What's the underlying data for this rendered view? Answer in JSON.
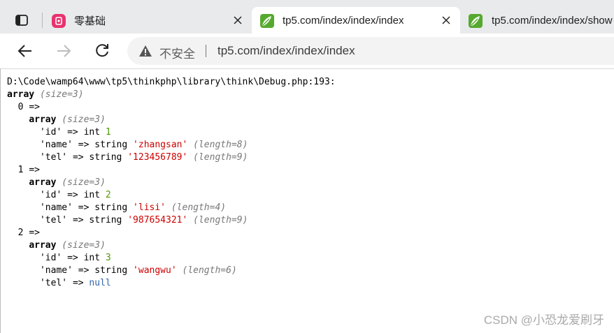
{
  "tabs": [
    {
      "title": "零基础",
      "favicon": "pink-app-icon"
    },
    {
      "title": "tp5.com/index/index/index",
      "favicon": "thinkphp-leaf-icon",
      "active": true
    },
    {
      "title": "tp5.com/index/index/show",
      "favicon": "thinkphp-leaf-icon"
    }
  ],
  "address_bar": {
    "security_label": "不安全",
    "url": "tp5.com/index/index/index"
  },
  "debug": {
    "path": "D:\\Code\\wamp64\\www\\tp5\\thinkphp\\library\\think\\Debug.php:193:",
    "array_kw": "array",
    "size3": "(size=3)",
    "arrow": "=>",
    "items": [
      {
        "index": "0",
        "id": "1",
        "name": "'zhangsan'",
        "name_len": "(length=8)",
        "tel": "'123456789'",
        "tel_len": "(length=9)"
      },
      {
        "index": "1",
        "id": "2",
        "name": "'lisi'",
        "name_len": "(length=4)",
        "tel": "'987654321'",
        "tel_len": "(length=9)"
      },
      {
        "index": "2",
        "id": "3",
        "name": "'wangwu'",
        "name_len": "(length=6)",
        "tel": "null"
      }
    ],
    "key_id": "'id'",
    "key_name": "'name'",
    "key_tel": "'tel'",
    "type_int": "int",
    "type_string": "string"
  },
  "watermark": "CSDN @小恐龙爱刷牙",
  "colors": {
    "number": "#4e9a06",
    "string": "#cc0000",
    "null": "#3465a4",
    "meta": "#777777"
  }
}
